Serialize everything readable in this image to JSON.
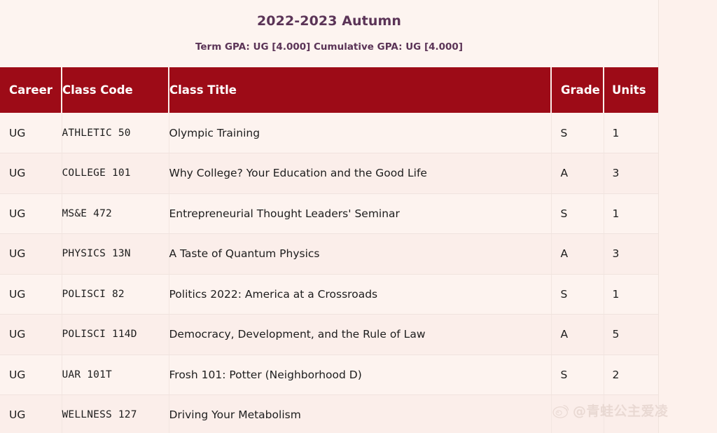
{
  "term": {
    "title": "2022-2023 Autumn",
    "gpa_line": "Term GPA: UG [4.000]  Cumulative GPA: UG [4.000]"
  },
  "table": {
    "columns": {
      "career": "Career",
      "class_code": "Class Code",
      "class_title": "Class Title",
      "grade": "Grade",
      "units": "Units"
    },
    "rows": [
      {
        "career": "UG",
        "class_code": "ATHLETIC  50",
        "class_title": "Olympic Training",
        "grade": "S",
        "units": "1"
      },
      {
        "career": "UG",
        "class_code": "COLLEGE  101",
        "class_title": "Why College? Your Education and the Good Life",
        "grade": "A",
        "units": "3"
      },
      {
        "career": "UG",
        "class_code": "MS&E  472",
        "class_title": "Entrepreneurial Thought Leaders' Seminar",
        "grade": "S",
        "units": "1"
      },
      {
        "career": "UG",
        "class_code": "PHYSICS  13N",
        "class_title": "A Taste of Quantum Physics",
        "grade": "A",
        "units": "3"
      },
      {
        "career": "UG",
        "class_code": "POLISCI  82",
        "class_title": "Politics 2022: America at a Crossroads",
        "grade": "S",
        "units": "1"
      },
      {
        "career": "UG",
        "class_code": "POLISCI  114D",
        "class_title": "Democracy, Development, and the Rule of Law",
        "grade": "A",
        "units": "5"
      },
      {
        "career": "UG",
        "class_code": "UAR  101T",
        "class_title": "Frosh 101: Potter (Neighborhood D)",
        "grade": "S",
        "units": "2"
      },
      {
        "career": "UG",
        "class_code": "WELLNESS  127",
        "class_title": "Driving Your Metabolism",
        "grade": "",
        "units": ""
      }
    ]
  },
  "watermark": {
    "handle": "@青蛙公主爱凌",
    "logo": "weibo-eye-icon"
  },
  "colors": {
    "header_red": "#9d0b17",
    "title_plum": "#5b3457",
    "page_bg": "#fdf4f0",
    "row_odd": "#fdf3ef",
    "row_even": "#fbeeea"
  }
}
